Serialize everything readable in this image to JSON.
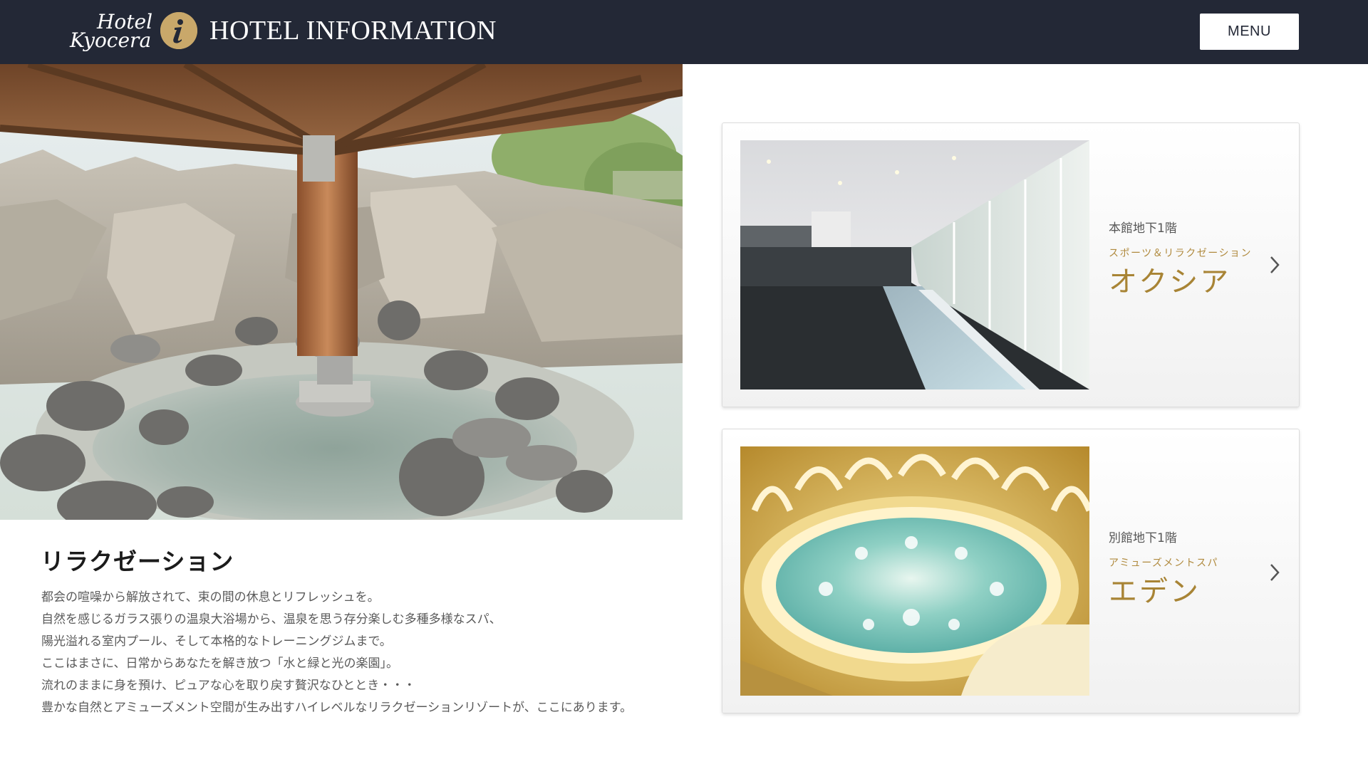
{
  "header": {
    "logo_line1": "Hotel",
    "logo_line2": "Kyocera",
    "info_icon": "info-icon",
    "title": "HOTEL INFORMATION",
    "menu_label": "MENU",
    "background_color": "#232836",
    "accent_color": "#c9a86a"
  },
  "hero": {
    "image": "outdoor-hot-spring-bath-photo"
  },
  "main": {
    "title": "リラクゼーション",
    "description": [
      "都会の喧噪から解放されて、束の間の休息とリフレッシュを。",
      "自然を感じるガラス張りの温泉大浴場から、温泉を思う存分楽しむ多種多様なスパ、",
      "陽光溢れる室内プール、そして本格的なトレーニングジムまで。",
      "ここはまさに、日常からあなたを解き放つ「水と緑と光の楽園」。",
      "流れのままに身を預け、ピュアな心を取り戻す贅沢なひととき・・・",
      "豊かな自然とアミューズメント空間が生み出すハイレベルなリラクゼーションリゾートが、ここにあります。"
    ]
  },
  "cards": [
    {
      "floor": "本館地下1階",
      "subtitle": "スポーツ＆リラクゼーション",
      "name": "オクシア",
      "image": "indoor-pool-photo",
      "arrow_icon": "chevron-right-icon"
    },
    {
      "floor": "別館地下1階",
      "subtitle": "アミューズメントスパ",
      "name": "エデン",
      "image": "circular-spa-pool-photo",
      "arrow_icon": "chevron-right-icon"
    }
  ],
  "colors": {
    "gold_text": "#a88435",
    "body_text": "#5a5a5a"
  }
}
